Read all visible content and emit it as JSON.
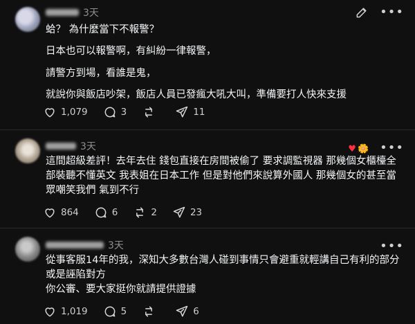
{
  "posts": [
    {
      "time": "3天",
      "paragraphs": [
        "蛤？ 為什麼當下不報警？",
        "日本也可以報警啊，有糾紛一律報警，",
        "請警方到場，看誰是鬼，",
        "就說你與飯店吵架，飯店人員已發瘋大吼大叫，準備要打人快來支援"
      ],
      "likes": "1,079",
      "comments": "3",
      "reposts": "",
      "shares": "11"
    },
    {
      "time": "3天",
      "paragraphs": [
        "這間超級差評！去年去住 錢包直接在房間被偷了 要求調監視器 那幾個女櫃檯全部裝聽不懂英文 我表姐在日本工作 但是對他們來說算外國人 那幾個女的甚至當眾嘲笑我們 氣到不行"
      ],
      "likes": "864",
      "comments": "6",
      "reposts": "2",
      "shares": "23"
    },
    {
      "time": "3天",
      "paragraphs": [
        "從事客服14年的我，深知大多數台灣人碰到事情只會避重就輕講自己有利的部分或是誣陷對方",
        "你公審、要大家挺你就請提供證據"
      ],
      "likes": "1,019",
      "comments": "5",
      "reposts": "",
      "shares": "6"
    }
  ],
  "icons": {
    "like": "heart-icon",
    "comment": "comment-icon",
    "repost": "repost-icon",
    "share": "send-icon",
    "edit": "pencil-icon",
    "more": "more-dots-icon",
    "reaction": "heart-flower-reaction-icon"
  },
  "colors": {
    "background": "#101010",
    "text": "#f3f5f7",
    "muted": "#8f8f8f",
    "divider": "#2a2a2a",
    "reaction_heart": "#ff3040"
  }
}
